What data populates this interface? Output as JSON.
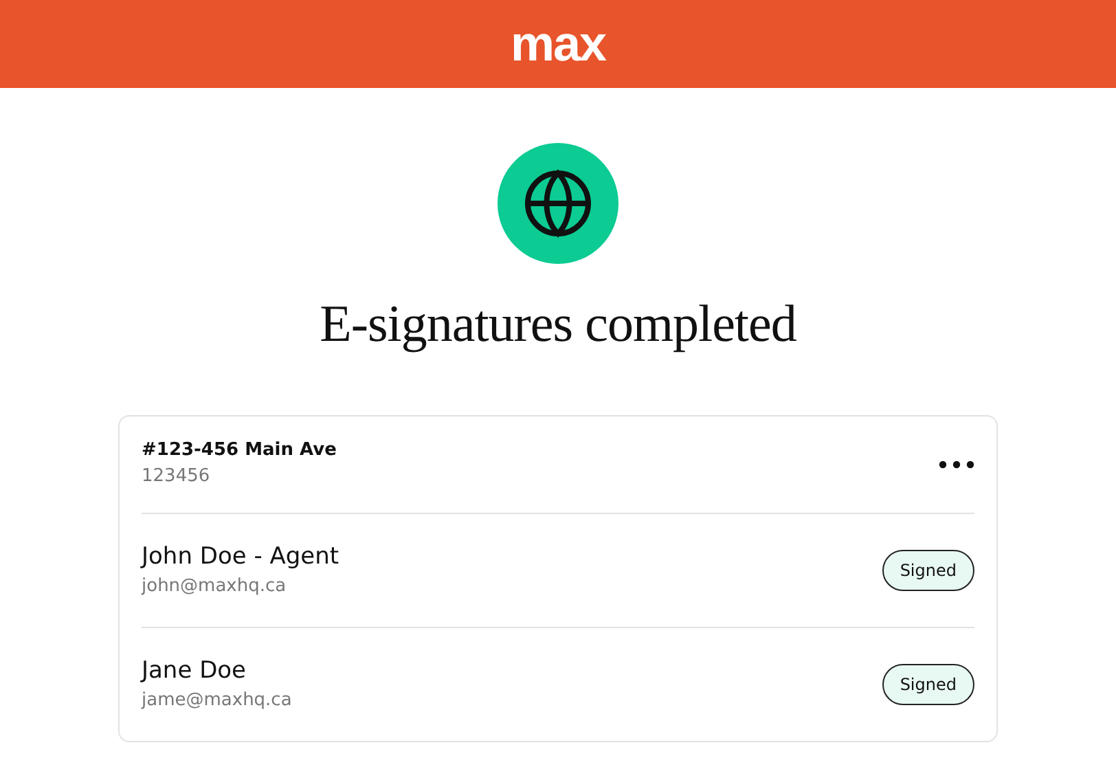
{
  "header": {
    "logo": "max"
  },
  "title": "E-signatures completed",
  "property": {
    "address": "#123-456 Main Ave",
    "number": "123456"
  },
  "signers": [
    {
      "name": "John Doe - Agent",
      "email": "john@maxhq.ca",
      "status": "Signed"
    },
    {
      "name": "Jane Doe",
      "email": "jame@maxhq.ca",
      "status": "Signed"
    }
  ]
}
